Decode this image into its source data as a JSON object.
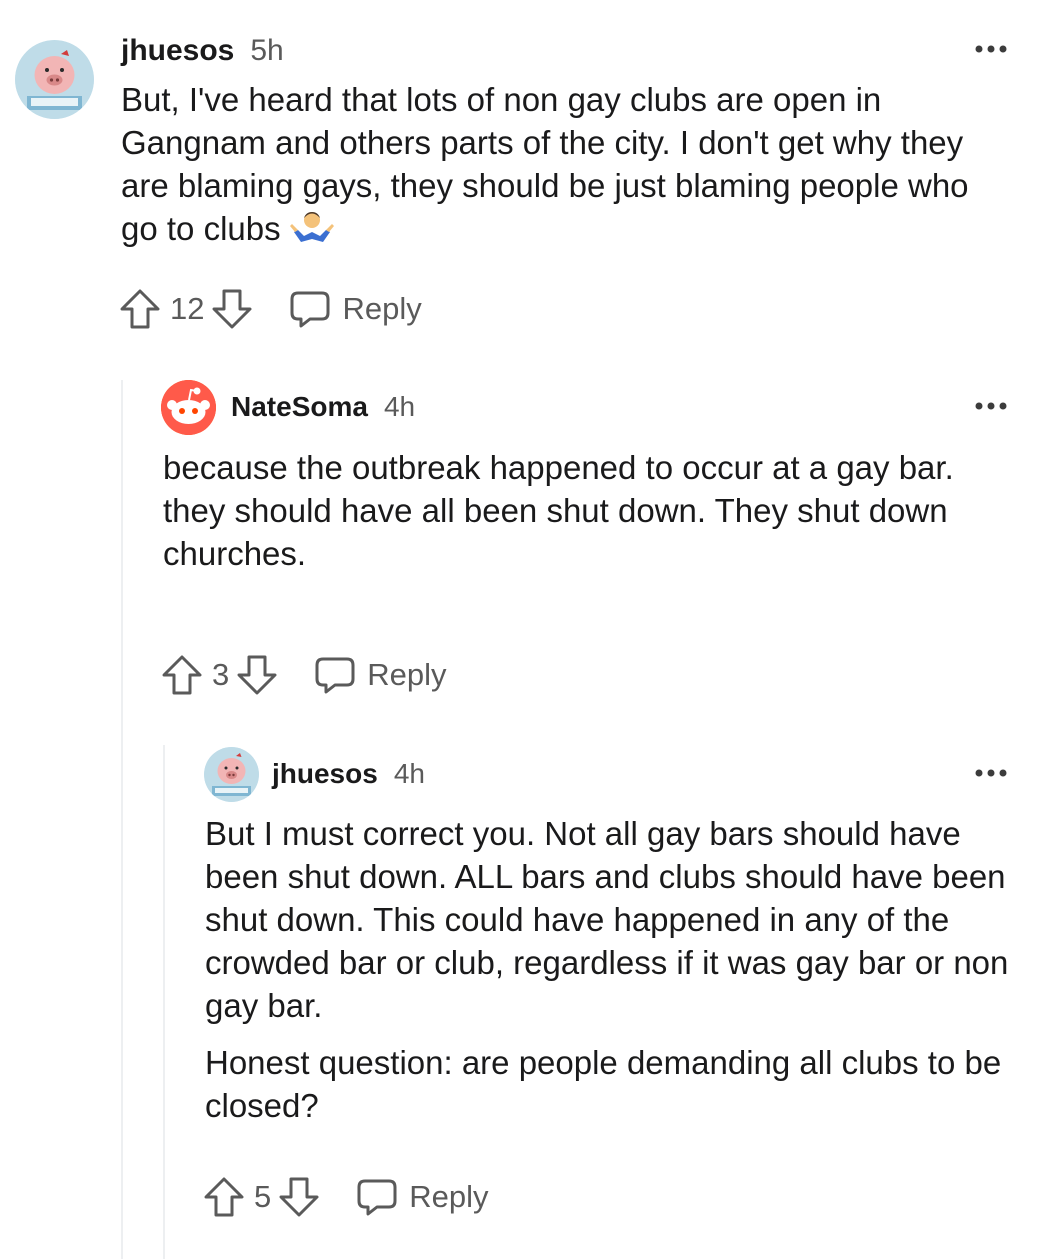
{
  "comments": [
    {
      "username": "jhuesos",
      "time": "5h",
      "body": [
        "But, I've heard that lots of non gay clubs are open in Gangnam and others parts of the city. I don't get why they are blaming gays, they should be just blaming people who go to clubs"
      ],
      "emoji": "person-shrugging",
      "votes": "12",
      "reply_label": "Reply",
      "avatar": "pig-avatar"
    },
    {
      "username": "NateSoma",
      "time": "4h",
      "body": [
        "because the outbreak happened to occur at a gay bar.",
        "they should have all been shut down. They shut down churches."
      ],
      "votes": "3",
      "reply_label": "Reply",
      "avatar": "snoo-avatar"
    },
    {
      "username": "jhuesos",
      "time": "4h",
      "body": [
        "But I must correct you. Not all gay bars should have been shut down. ALL bars and clubs should have been shut down. This could have happened in any of the crowded bar or club, regardless if it was gay bar or non gay bar.",
        "Honest question: are people demanding all clubs to be closed?"
      ],
      "votes": "5",
      "reply_label": "Reply",
      "avatar": "pig-avatar"
    }
  ],
  "colors": {
    "text": "#1a1a1b",
    "meta": "#5a5a5a",
    "thread_line": "#edeff1",
    "snoo_red": "#ff4500"
  }
}
